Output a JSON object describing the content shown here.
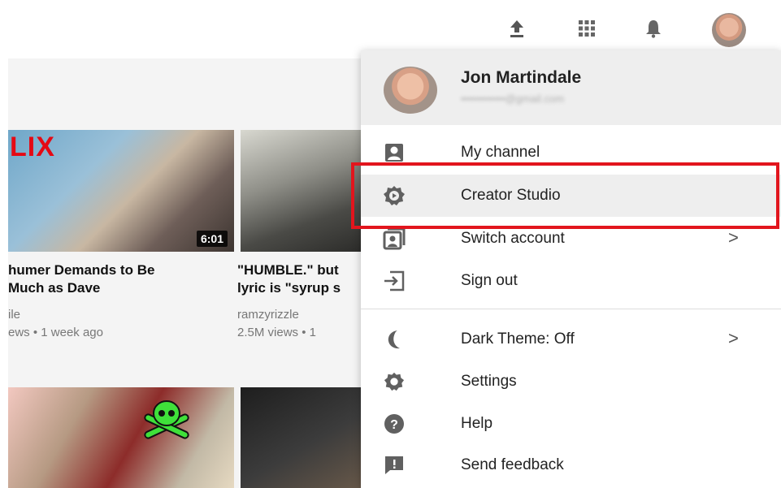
{
  "topbar": {
    "icons": [
      "upload-icon",
      "apps-grid-icon",
      "notifications-bell-icon"
    ]
  },
  "videos": [
    {
      "title_line1": "humer Demands to Be",
      "title_line2": " Much as Dave",
      "channel": "ile",
      "meta": "ews • 1 week ago",
      "duration": "6:01",
      "badge": "LIX"
    },
    {
      "title_line1": "\"HUMBLE.\" but",
      "title_line2": "lyric is \"syrup s",
      "channel": "ramzyrizzle",
      "meta": "2.5M views • 1"
    }
  ],
  "account_menu": {
    "user_name": "Jon Martindale",
    "user_email": "••••••••••••@gmail.com",
    "items": [
      {
        "label": "My channel",
        "icon": "person-icon",
        "chevron": ""
      },
      {
        "label": "Creator Studio",
        "icon": "gear-play-icon",
        "chevron": ""
      },
      {
        "label": "Switch account",
        "icon": "switch-account-icon",
        "chevron": ">"
      },
      {
        "label": "Sign out",
        "icon": "sign-out-icon",
        "chevron": ""
      },
      {
        "label": "Dark Theme: Off",
        "icon": "moon-icon",
        "chevron": ">"
      },
      {
        "label": "Settings",
        "icon": "gear-icon",
        "chevron": ""
      },
      {
        "label": "Help",
        "icon": "help-icon",
        "chevron": ""
      },
      {
        "label": "Send feedback",
        "icon": "feedback-icon",
        "chevron": ""
      }
    ]
  },
  "colors": {
    "highlight_box": "#e2151d",
    "menu_header_bg": "#eeeeee",
    "icon_gray": "#606060"
  }
}
